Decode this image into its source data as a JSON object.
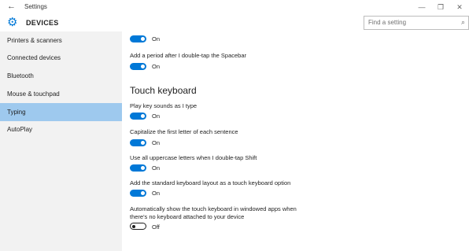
{
  "window": {
    "title": "Settings",
    "back_glyph": "←",
    "minimize_glyph": "—",
    "maximize_glyph": "❐",
    "close_glyph": "✕"
  },
  "header": {
    "section": "DEVICES",
    "icon": "gear-icon",
    "search_placeholder": "Find a setting",
    "search_icon": "search-icon"
  },
  "sidebar": {
    "items": [
      {
        "label": "Printers & scanners",
        "active": false
      },
      {
        "label": "Connected devices",
        "active": false
      },
      {
        "label": "Bluetooth",
        "active": false
      },
      {
        "label": "Mouse & touchpad",
        "active": false
      },
      {
        "label": "Typing",
        "active": true
      },
      {
        "label": "AutoPlay",
        "active": false
      }
    ]
  },
  "content": {
    "top_toggle_state": "On",
    "period_label": "Add a period after I double-tap the Spacebar",
    "period_state": "On",
    "touch_heading": "Touch keyboard",
    "settings": [
      {
        "label": "Play key sounds as I type",
        "state": "On"
      },
      {
        "label": "Capitalize the first letter of each sentence",
        "state": "On"
      },
      {
        "label": "Use all uppercase letters when I double-tap Shift",
        "state": "On"
      },
      {
        "label": "Add the standard keyboard layout as a touch keyboard option",
        "state": "On"
      }
    ],
    "auto_show_label_line1": "Automatically show the touch keyboard in windowed apps when",
    "auto_show_label_line2": "there's no keyboard attached to your device",
    "auto_show_state": "Off"
  },
  "colors": {
    "accent": "#0078d7",
    "sidebar_bg": "#f2f2f2",
    "sidebar_active": "#9ec9ee"
  }
}
